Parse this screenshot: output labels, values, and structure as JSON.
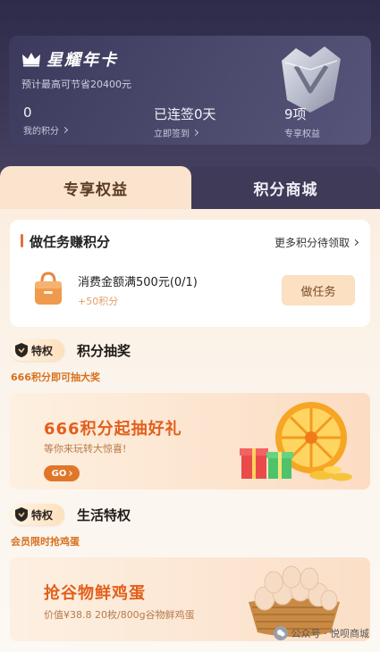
{
  "vip": {
    "title": "星耀年卡",
    "subtitle": "预计最高可节省20400元",
    "points_value": "0",
    "points_label": "我的积分",
    "checkin_value": "已连签0天",
    "checkin_label": "立即签到",
    "benefits_value": "9项",
    "benefits_label": "专享权益"
  },
  "tabs": [
    {
      "label": "专享权益",
      "active": true
    },
    {
      "label": "积分商城",
      "active": false
    }
  ],
  "task_section": {
    "title": "做任务赚积分",
    "more_label": "更多积分待领取",
    "task_name": "消费金额满500元(0/1)",
    "task_points": "+50积分",
    "task_button": "做任务"
  },
  "lottery": {
    "badge": "特权",
    "title": "积分抽奖",
    "subtitle": "666积分即可抽大奖",
    "banner_title": "666积分起抽好礼",
    "banner_sub": "等你来玩转大惊喜!",
    "go_label": "GO"
  },
  "life": {
    "badge": "特权",
    "title": "生活特权",
    "subtitle": "会员限时抢鸡蛋",
    "banner_title": "抢谷物鲜鸡蛋",
    "banner_sub": "价值¥38.8 20枚/800g谷物鲜鸡蛋"
  },
  "watermark": "公众号 · 悦呗商城",
  "colors": {
    "accent_orange": "#e35f1b",
    "dark_header": "#3b3a5c",
    "tab_active_bg": "#fbe4cd"
  }
}
